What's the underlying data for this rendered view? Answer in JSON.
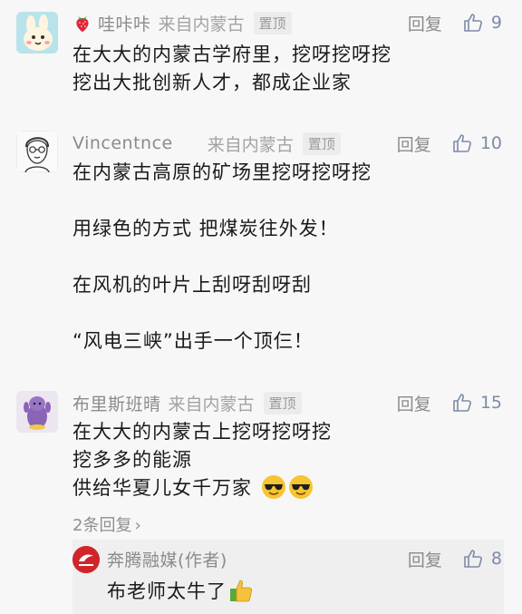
{
  "comments": [
    {
      "name": "哇咔咔",
      "location": "来自内蒙古",
      "pin": "置顶",
      "reply": "回复",
      "likes": "9",
      "lines": [
        "在大大的内蒙古学府里，挖呀挖呀挖",
        "挖出大批创新人才，都成企业家"
      ]
    },
    {
      "name": "Vincentnce",
      "location": "来自内蒙古",
      "pin": "置顶",
      "reply": "回复",
      "likes": "10",
      "lines": [
        "在内蒙古高原的矿场里挖呀挖呀挖",
        "用绿色的方式  把煤炭往外发！",
        "在风机的叶片上刮呀刮呀刮",
        "“风电三峡”出手一个顶仨！"
      ]
    },
    {
      "name": "布里斯班晴",
      "location": "来自内蒙古",
      "pin": "置顶",
      "reply": "回复",
      "likes": "15",
      "lines": [
        "在大大的内蒙古上挖呀挖呀挖",
        "挖多多的能源",
        "供给华夏儿女千万家"
      ],
      "more_replies": "2条回复"
    }
  ],
  "author_reply": {
    "name": "奔腾融媒(作者)",
    "reply": "回复",
    "likes": "8",
    "text": "布老师太牛了"
  },
  "icons": {
    "strawberry": "strawberry-icon",
    "thumb": "thumbs-up-icon",
    "sunglasses": "sunglasses-emoji-icon",
    "thumbs_up_emoji": "thumbs-up-emoji-icon"
  },
  "colors": {
    "like_count": "#7d8aa8",
    "meta_text": "#8b8b8b",
    "background": "#f7f7f7"
  }
}
